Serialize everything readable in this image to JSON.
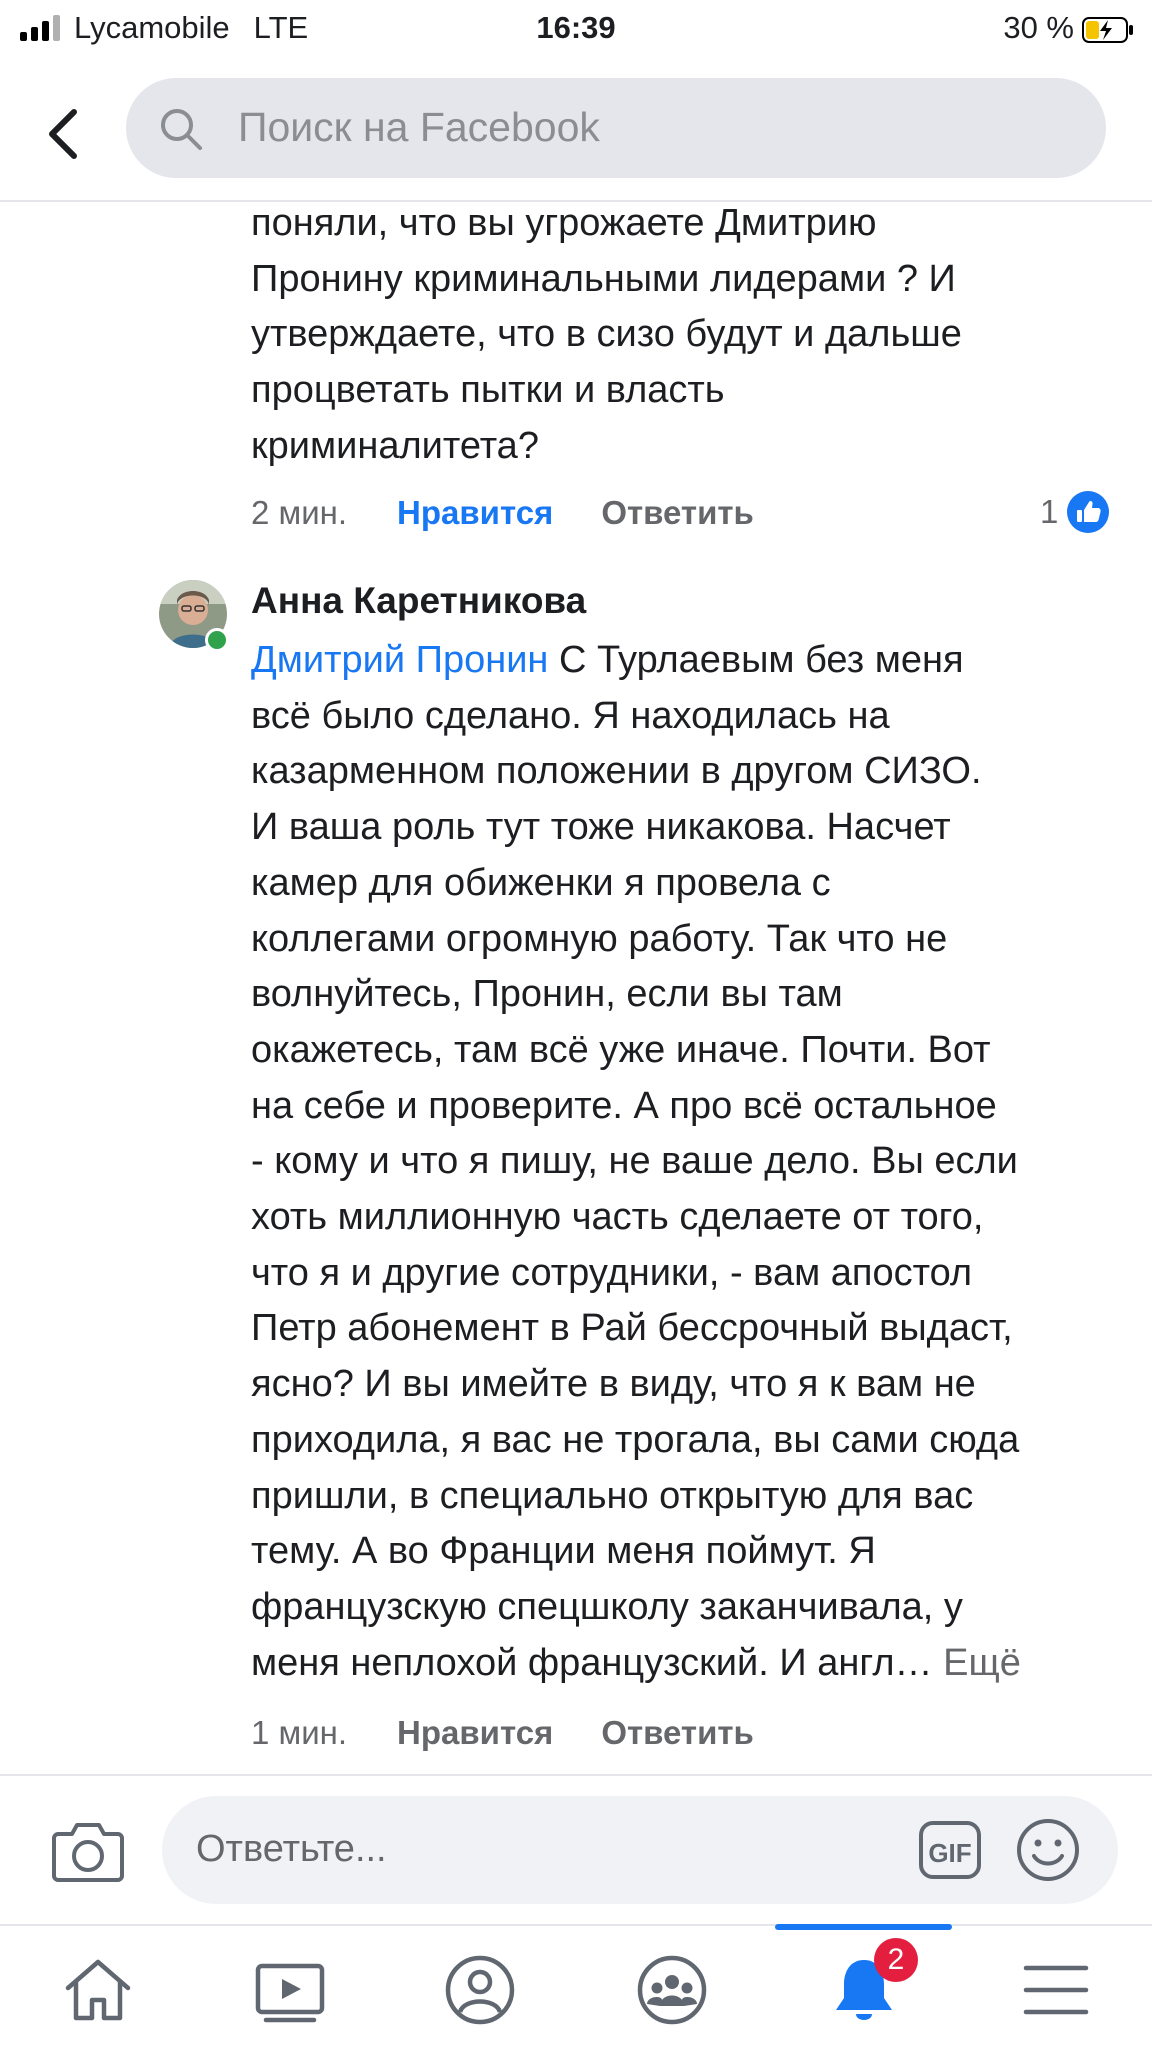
{
  "status_bar": {
    "carrier": "Lycamobile",
    "network": "LTE",
    "time": "16:39",
    "battery": "30 %"
  },
  "header": {
    "search_placeholder": "Поиск на Facebook"
  },
  "comment1": {
    "lines": [
      "поняли, что вы угрожаете Дмитрию",
      "Пронину криминальными лидерами ? И",
      "утверждаете, что в сизо будут и дальше",
      "процветать пытки и власть",
      "криминалитета?"
    ],
    "time": "2 мин.",
    "like_label": "Нравится",
    "reply_label": "Ответить",
    "reaction_count": "1"
  },
  "comment2": {
    "author": "Анна Каретникова",
    "mention": "Дмитрий Пронин",
    "first_line_rest": " С Турлаевым без меня",
    "lines": [
      "всё было сделано. Я находилась на",
      "казарменном положении в другом СИЗО.",
      "И ваша роль тут тоже никакова. Насчет",
      "камер для обиженки я провела с",
      "коллегами огромную работу. Так что не",
      "волнуйтесь, Пронин, если вы там",
      "окажетесь, там всё уже иначе. Почти. Вот",
      "на себе и проверите. А про всё остальное",
      "- кому и что я пишу, не ваше дело. Вы если",
      "хоть миллионную часть сделаете от того,",
      "что я и другие сотрудники, - вам апостол",
      "Петр абонемент в Рай бессрочный выдаст,",
      "ясно? И вы имейте в виду, что я к вам не",
      "приходила, я вас не трогала, вы сами сюда",
      "пришли, в специально открытую для вас",
      "тему. А во Франции меня поймут. Я",
      "французскую спецшколу заканчивала, у"
    ],
    "last_line": "меня неплохой французский. И англ…",
    "more_label": "Ещё",
    "time": "1 мин.",
    "like_label": "Нравится",
    "reply_label": "Ответить"
  },
  "reply_bar": {
    "placeholder": "Ответьте...",
    "gif_label": "GIF"
  },
  "tab_bar": {
    "items": [
      "home-icon",
      "video-icon",
      "profile-icon",
      "groups-icon",
      "notifications-icon",
      "menu-icon"
    ],
    "active": "notifications-icon",
    "notifications_badge": "2"
  },
  "colors": {
    "accent": "#1877f2",
    "badge": "#e41e3f",
    "online": "#31a24c"
  }
}
